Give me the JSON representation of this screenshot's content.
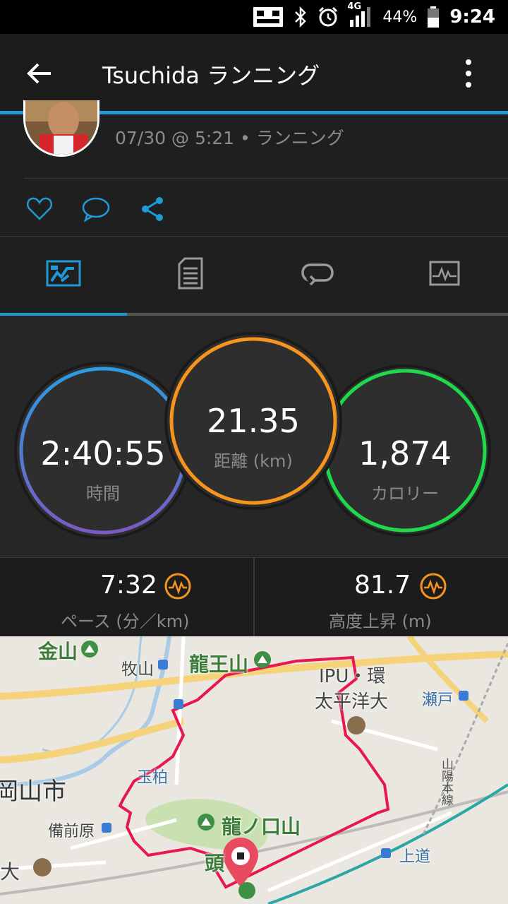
{
  "status_bar": {
    "network": "4G",
    "battery": "44%",
    "time": "9:24",
    "icons": [
      "notification-icon",
      "bluetooth-icon",
      "alarm-icon",
      "signal-icon",
      "battery-icon"
    ]
  },
  "app_bar": {
    "title": "Tsuchida ランニング",
    "back_icon": "arrow-left-icon",
    "menu_icon": "more-vert-icon"
  },
  "header": {
    "meta": "07/30 @ 5:21 • ランニング",
    "actions": [
      "heart-icon",
      "comment-icon",
      "share-icon"
    ]
  },
  "tabs": [
    {
      "icon": "summary-icon",
      "active": true
    },
    {
      "icon": "details-icon",
      "active": false
    },
    {
      "icon": "laps-icon",
      "active": false
    },
    {
      "icon": "chart-icon",
      "active": false
    }
  ],
  "stats": {
    "time": {
      "value": "2:40:55",
      "label": "時間"
    },
    "distance": {
      "value": "21.35",
      "label": "距離 (km)"
    },
    "calories": {
      "value": "1,874",
      "label": "カロリー"
    }
  },
  "secondary": {
    "pace": {
      "value": "7:32",
      "label": "ペース (分／km)"
    },
    "elevation": {
      "value": "81.7",
      "label": "高度上昇 (m)"
    }
  },
  "colors": {
    "accent": "#1e9ad6",
    "time_ring_start": "#2b9ce0",
    "time_ring_end": "#7a5bc4",
    "distance_ring": "#f7941d",
    "calories_ring": "#1ed94a",
    "route": "#e8174f"
  },
  "map": {
    "labels": {
      "kanayama": "金山",
      "makiyama": "牧山",
      "ryuouzan": "龍王山",
      "ipu1": "IPU・環",
      "ipu2": "太平洋大",
      "seto": "瀬戸",
      "tamagashi": "玉柏",
      "okayama": "岡山市",
      "bizenhara": "備前原",
      "tatsunokuchi": "龍ノ口山",
      "kami": "上道",
      "sanyo": "山陽本線",
      "kashira": "頭",
      "dai": "大"
    }
  }
}
